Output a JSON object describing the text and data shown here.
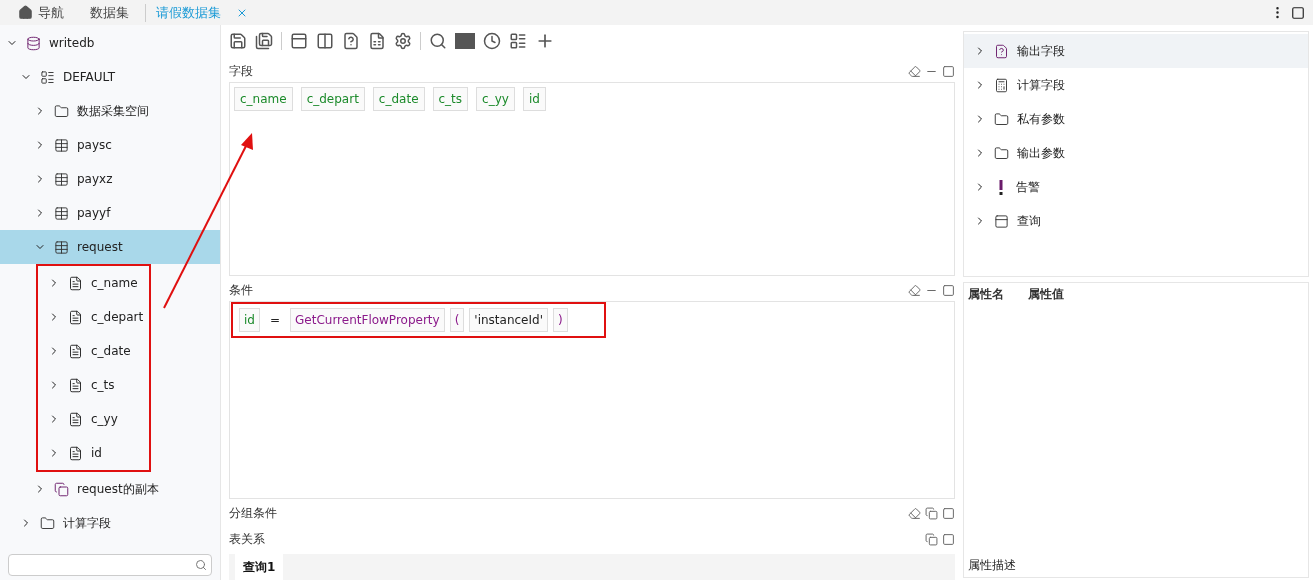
{
  "tabs": [
    {
      "label": "导航",
      "kind": "home",
      "selected": false
    },
    {
      "label": "数据集",
      "kind": "plain",
      "selected": false
    },
    {
      "label": "请假数据集",
      "kind": "closable",
      "selected": true
    }
  ],
  "sidebar": {
    "tree": [
      {
        "label": "writedb",
        "kind": "database",
        "expanded": true,
        "selected": false,
        "children": [
          {
            "label": "DEFAULT",
            "kind": "schema",
            "expanded": true,
            "selected": false,
            "children": [
              {
                "label": "数据采集空间",
                "kind": "folder",
                "expanded": false,
                "selected": false
              },
              {
                "label": "paysc",
                "kind": "table",
                "expanded": false,
                "selected": false
              },
              {
                "label": "payxz",
                "kind": "table",
                "expanded": false,
                "selected": false
              },
              {
                "label": "payyf",
                "kind": "table",
                "expanded": false,
                "selected": false
              },
              {
                "label": "request",
                "kind": "table",
                "expanded": true,
                "selected": true,
                "annotated": true,
                "children": [
                  {
                    "label": "c_name",
                    "kind": "column",
                    "expanded": false,
                    "selected": false
                  },
                  {
                    "label": "c_depart",
                    "kind": "column",
                    "expanded": false,
                    "selected": false
                  },
                  {
                    "label": "c_date",
                    "kind": "column",
                    "expanded": false,
                    "selected": false
                  },
                  {
                    "label": "c_ts",
                    "kind": "column",
                    "expanded": false,
                    "selected": false
                  },
                  {
                    "label": "c_yy",
                    "kind": "column",
                    "expanded": false,
                    "selected": false
                  },
                  {
                    "label": "id",
                    "kind": "column",
                    "expanded": false,
                    "selected": false
                  }
                ]
              },
              {
                "label": "request的副本",
                "kind": "copy",
                "expanded": false,
                "selected": false
              }
            ]
          },
          {
            "label": "计算字段",
            "kind": "folder",
            "expanded": false,
            "selected": false
          }
        ]
      }
    ]
  },
  "sections": [
    {
      "title": "字段",
      "kind": "fields",
      "chips": [
        "c_name",
        "c_depart",
        "c_date",
        "c_ts",
        "c_yy",
        "id"
      ]
    },
    {
      "title": "条件",
      "kind": "condition",
      "annotated": true,
      "tokens": [
        {
          "text": "id",
          "kind": "field"
        },
        {
          "text": "=",
          "kind": "operator"
        },
        {
          "text": "GetCurrentFlowProperty",
          "kind": "function"
        },
        {
          "text": "(",
          "kind": "paren"
        },
        {
          "text": "'instanceId'",
          "kind": "string"
        },
        {
          "text": ")",
          "kind": "paren"
        }
      ]
    },
    {
      "title": "分组条件",
      "kind": "group"
    },
    {
      "title": "表关系",
      "kind": "relation"
    }
  ],
  "query_tabs": [
    {
      "label": "查询1",
      "selected": true
    }
  ],
  "outline": [
    {
      "label": "输出字段",
      "kind": "help-doc",
      "selected": true
    },
    {
      "label": "计算字段",
      "kind": "calculator",
      "selected": false
    },
    {
      "label": "私有参数",
      "kind": "folder",
      "selected": false
    },
    {
      "label": "输出参数",
      "kind": "folder",
      "selected": false
    },
    {
      "label": "告警",
      "kind": "alert",
      "selected": false
    },
    {
      "label": "查询",
      "kind": "query",
      "selected": false
    }
  ],
  "properties": {
    "columns": [
      "属性名",
      "属性值"
    ],
    "description_label": "属性描述"
  }
}
